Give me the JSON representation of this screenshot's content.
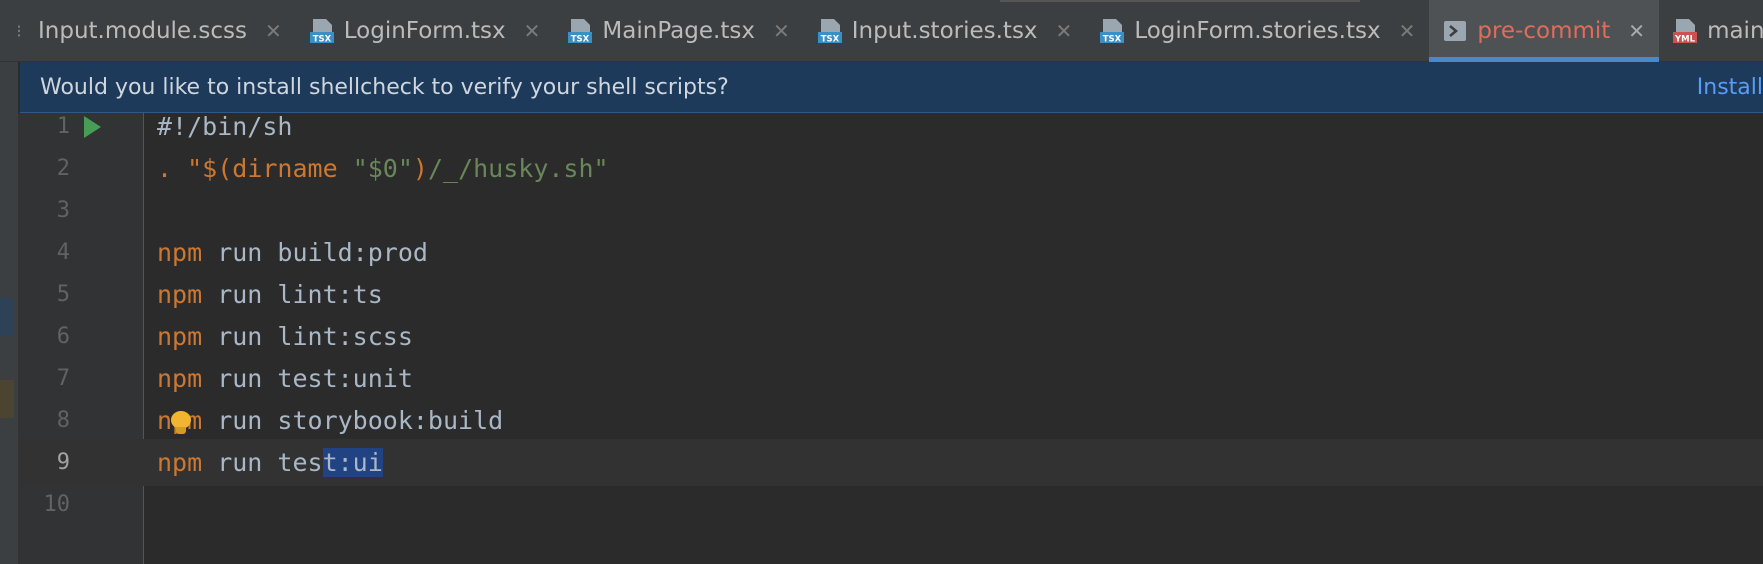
{
  "tabs": [
    {
      "label": "Input.module.scss",
      "icon": "scss-file-icon",
      "active": false
    },
    {
      "label": "LoginForm.tsx",
      "icon": "tsx-file-icon",
      "active": false
    },
    {
      "label": "MainPage.tsx",
      "icon": "tsx-file-icon",
      "active": false
    },
    {
      "label": "Input.stories.tsx",
      "icon": "tsx-file-icon",
      "active": false
    },
    {
      "label": "LoginForm.stories.tsx",
      "icon": "tsx-file-icon",
      "active": false
    },
    {
      "label": "pre-commit",
      "icon": "shell-file-icon",
      "active": true
    },
    {
      "label": "main.yml",
      "icon": "yml-file-icon",
      "active": false
    }
  ],
  "file_icon_text": {
    "tsx": "TSX",
    "yml": "YML"
  },
  "close_glyph": "✕",
  "banner": {
    "message": "Would you like to install shellcheck to verify your shell scripts?",
    "action": "Install"
  },
  "editor": {
    "current_line": 9,
    "lines": [
      {
        "number": "1",
        "text": "#!/bin/sh"
      },
      {
        "number": "2",
        "text": ". \"$(dirname \"$0\")/_/husky.sh\""
      },
      {
        "number": "3",
        "text": ""
      },
      {
        "number": "4",
        "text": "npm run build:prod"
      },
      {
        "number": "5",
        "text": "npm run lint:ts"
      },
      {
        "number": "6",
        "text": "npm run lint:scss"
      },
      {
        "number": "7",
        "text": "npm run test:unit"
      },
      {
        "number": "8",
        "text": "npm run storybook:build"
      },
      {
        "number": "9",
        "text": "npm run test:ui"
      }
    ],
    "selection": "t:ui"
  },
  "colors": {
    "keyword": "#cc7832",
    "string": "#6a8759",
    "active_tab_text": "#e06c5a",
    "tab_underline": "#4a88c7",
    "banner_bg": "#1d3a5b",
    "link": "#589df6"
  }
}
